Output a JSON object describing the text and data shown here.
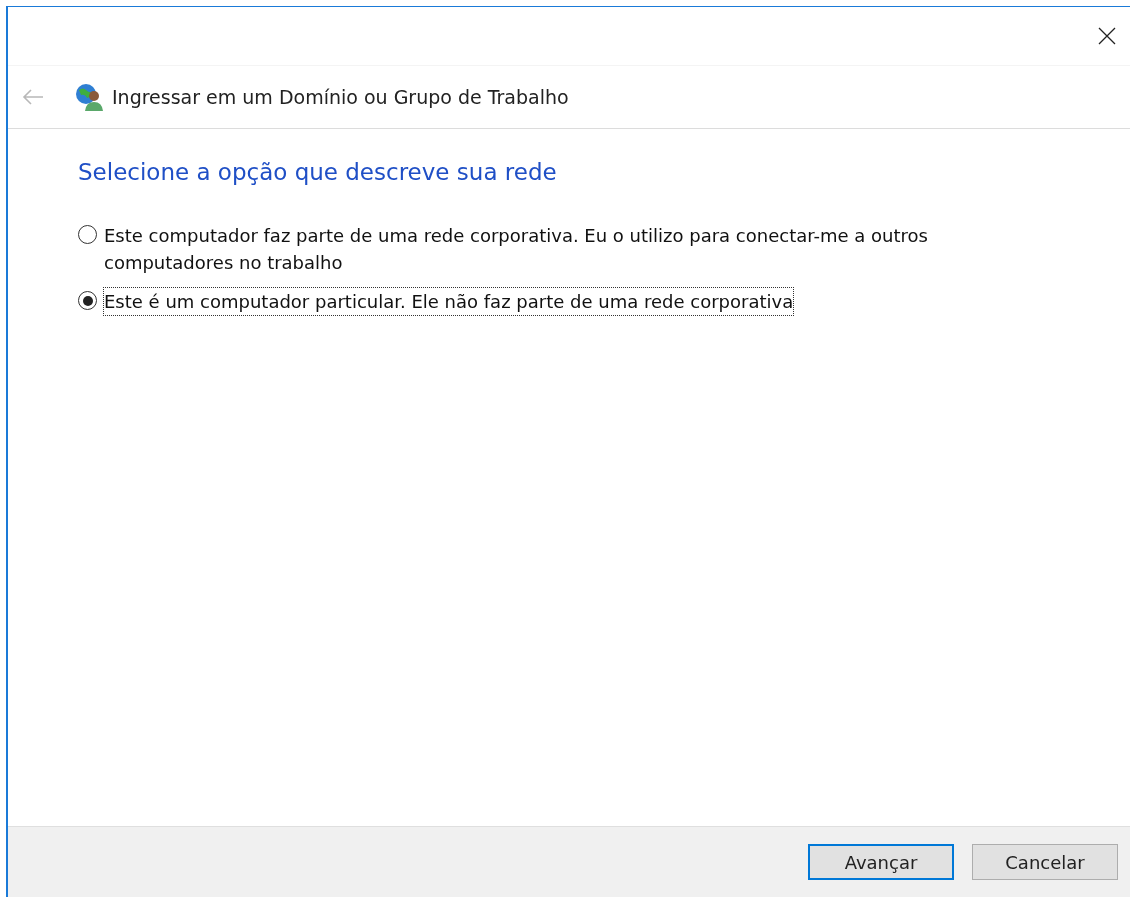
{
  "window": {
    "title": "Ingressar em um Domínio ou Grupo de Trabalho",
    "back_disabled": true
  },
  "heading": "Selecione a opção que descreve sua rede",
  "options": [
    {
      "label": "Este computador faz parte de uma rede corporativa. Eu o utilizo para conectar-me a outros computadores no trabalho",
      "selected": false,
      "focused": false
    },
    {
      "label": "Este é um computador particular. Ele não faz parte de uma rede corporativa",
      "selected": true,
      "focused": true
    }
  ],
  "buttons": [
    {
      "label": "Avançar",
      "default": true
    },
    {
      "label": "Cancelar",
      "default": false
    }
  ]
}
